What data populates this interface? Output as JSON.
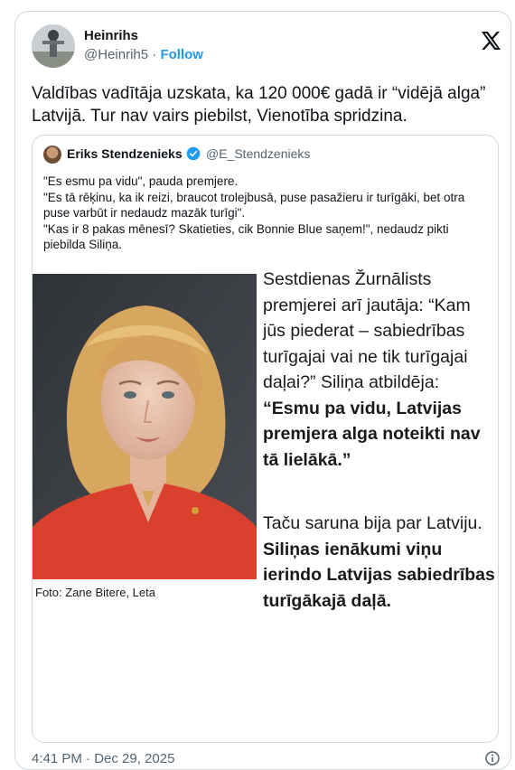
{
  "author": {
    "name": "Heinrihs",
    "handle": "@Heinrih5",
    "separator": "·",
    "follow_label": "Follow"
  },
  "x_icon": "x-logo-icon",
  "tweet": {
    "text": "Valdības vadītāja uzskata, ka 120 000€ gadā ir “vidējā alga” Latvijā. Tur nav vairs piebilst, Vienotība spridzina."
  },
  "quoted": {
    "name": "Eriks Stendzenieks",
    "verified_icon": "verified-badge-icon",
    "handle": "@E_Stendzenieks",
    "lines": [
      "\"Es esmu pa vidu\", pauda premjere.",
      "\"Es tā rēķinu, ka ik reizi, braucot trolejbusā, puse pasažieru ir turīgāki, bet otra puse varbūt ir nedaudz mazāk turīgi\".",
      "\"Kas ir 8 pakas mēnesī? Skatieties, cik Bonnie Blue saņem!\", nedaudz pikti piebilda Siliņa."
    ],
    "photo_caption": "Foto: Zane Bitere, Leta",
    "article": {
      "p1_plain": "Sestdienas Žurnālists premjerei arī jautāja: “Kam jūs piederat – sabiedrības turīgajai vai ne tik turīgajai daļai?” Siliņa atbildēja: ",
      "p1_bold": "“Esmu pa vidu, Latvijas premjera alga noteikti nav tā lielākā.”",
      "p2_plain": "Taču saruna bija par Latviju. ",
      "p2_bold": "Siliņas ienākumi viņu ierindo Latvijas sabiedrības turīgākajā daļā."
    }
  },
  "footer": {
    "timestamp": "4:41 PM · Dec 29, 2025",
    "info_icon": "info-icon"
  },
  "colors": {
    "accent": "#1d9bf0",
    "text": "#0f1419",
    "muted": "#536471",
    "border": "#cfd9de",
    "jacket": "#d9412e"
  }
}
